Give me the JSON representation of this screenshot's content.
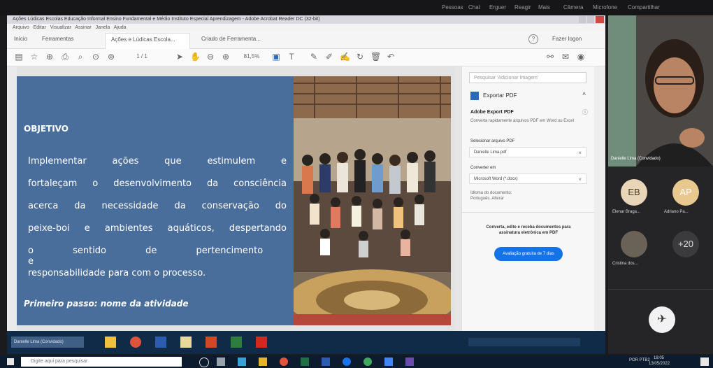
{
  "meeting": {
    "top_tabs": [
      "Pessoas",
      "Chat",
      "Erguer",
      "Reagir",
      "Mais",
      "Câmera",
      "Microfone",
      "Compartilhar"
    ]
  },
  "acrobat": {
    "window_title": "Ações Lúdicas Escolas Educação Informal Ensino Fundamental e Médio Instituto Especial Aprendizagem - Adobe Acrobat Reader DC (32-bit)",
    "menu": [
      "Arquivo",
      "Editar",
      "Visualizar",
      "Assinar",
      "Janela",
      "Ajuda"
    ],
    "tabs": [
      "Início",
      "Ferramentas",
      "Ações e Lúdicas Escola...",
      "Criado de Ferramenta..."
    ],
    "signin": "Fazer logon",
    "zoom": "81,5%",
    "slide": {
      "heading": "OBJETIVO",
      "body_lines": [
        "Implementar ações que estimulem e",
        "fortaleçam o desenvolvimento da consciência",
        "acerca da necessidade da conservação do",
        "peixe-boi e ambientes aquáticos, despertando",
        "o sentido de pertencimento e",
        "responsabilidade para com o processo."
      ],
      "subheading": "Primeiro passo: nome da atividade"
    },
    "side_panel": {
      "search_placeholder": "Pesquisar 'Adicionar Imagem'",
      "export_title": "Exportar PDF",
      "export_heading": "Adobe Export PDF",
      "export_desc": "Converta rapidamente arquivos PDF em Word ou Excel",
      "select_label": "Selecionar arquivo PDF",
      "file_name": "Danielle Lima.pdf",
      "convert_label": "Converter em",
      "convert_value": "Microsoft Word (*.docx)",
      "lang_label": "Idioma do documento:",
      "lang_value": "Português. Alterar",
      "promo_text": "Converta, edite e receba documentos para assinatura eletrônica em PDF",
      "trial_button": "Avaliação gratuita de 7 dias"
    },
    "taskbar_label": "Danielle Lima (Convidado)"
  },
  "participants": {
    "speaker_name": "Danielle Lima (Convidado)",
    "tiles": [
      {
        "initials": "EB",
        "name": "Elenar Braga...",
        "color": "#e9d5b8",
        "text_color": "#4a3a20"
      },
      {
        "initials": "AP",
        "name": "Adriano Pa...",
        "color": "#e9c88f",
        "text_color": "#ffffff"
      },
      {
        "initials": "",
        "name": "Cristina dos...",
        "color": "#6b6257",
        "text_color": "#ffffff"
      },
      {
        "initials": "+20",
        "name": "",
        "color": "#3b3b3e",
        "text_color": "#e0e0e0"
      }
    ]
  },
  "os": {
    "search_placeholder": "Digite aqui para pesquisar",
    "time": "18:05",
    "date": "13/05/2022",
    "lang": "POR PTB2"
  }
}
